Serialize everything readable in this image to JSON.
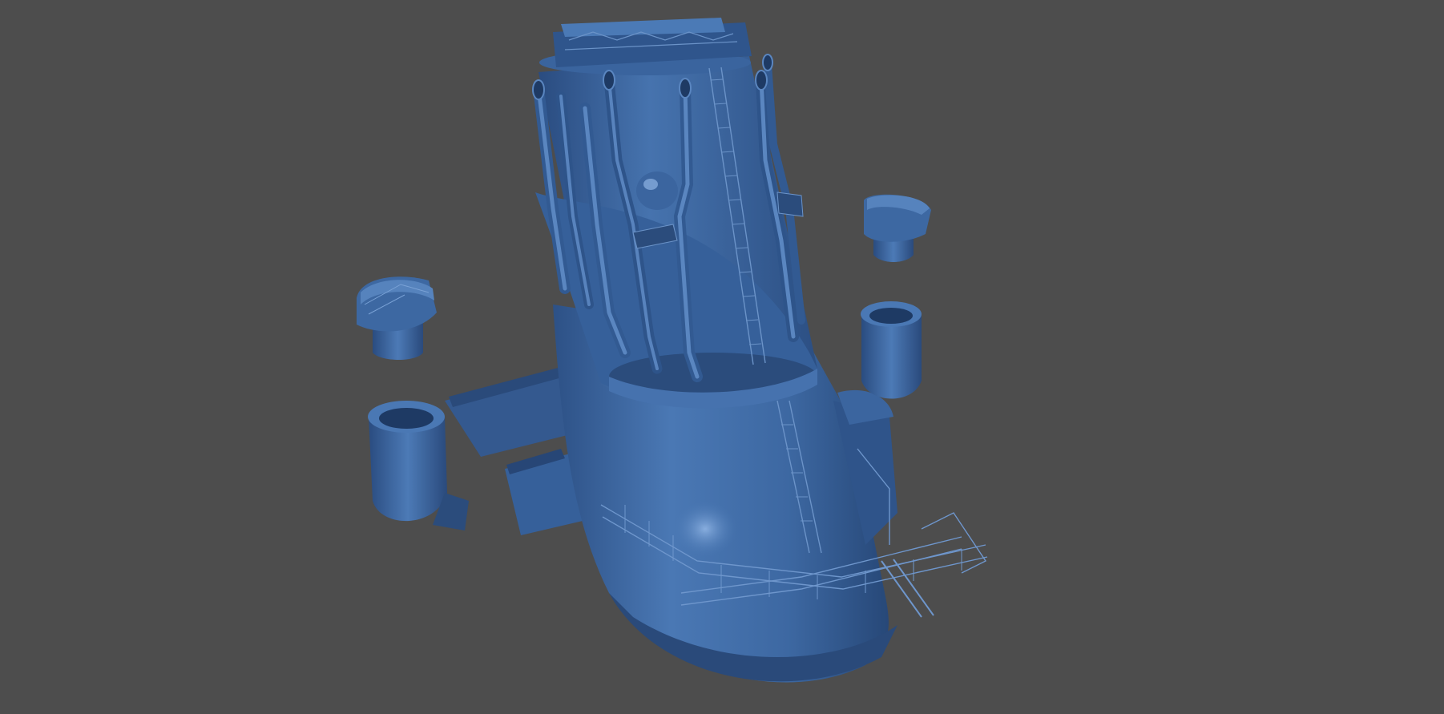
{
  "viewport": {
    "background_color": "#4d4d4d"
  },
  "model": {
    "base_color": "#3f6aa3",
    "shade_color": "#2b4c7c",
    "dark_color": "#1e3a64",
    "highlight_color": "#6e98cf",
    "parts": [
      "funnel-stack",
      "exhaust-pipe",
      "access-ladder",
      "searchlight-platform",
      "foremast-base",
      "railing-walkway",
      "detached-vent-cap",
      "detached-cylinder"
    ]
  }
}
